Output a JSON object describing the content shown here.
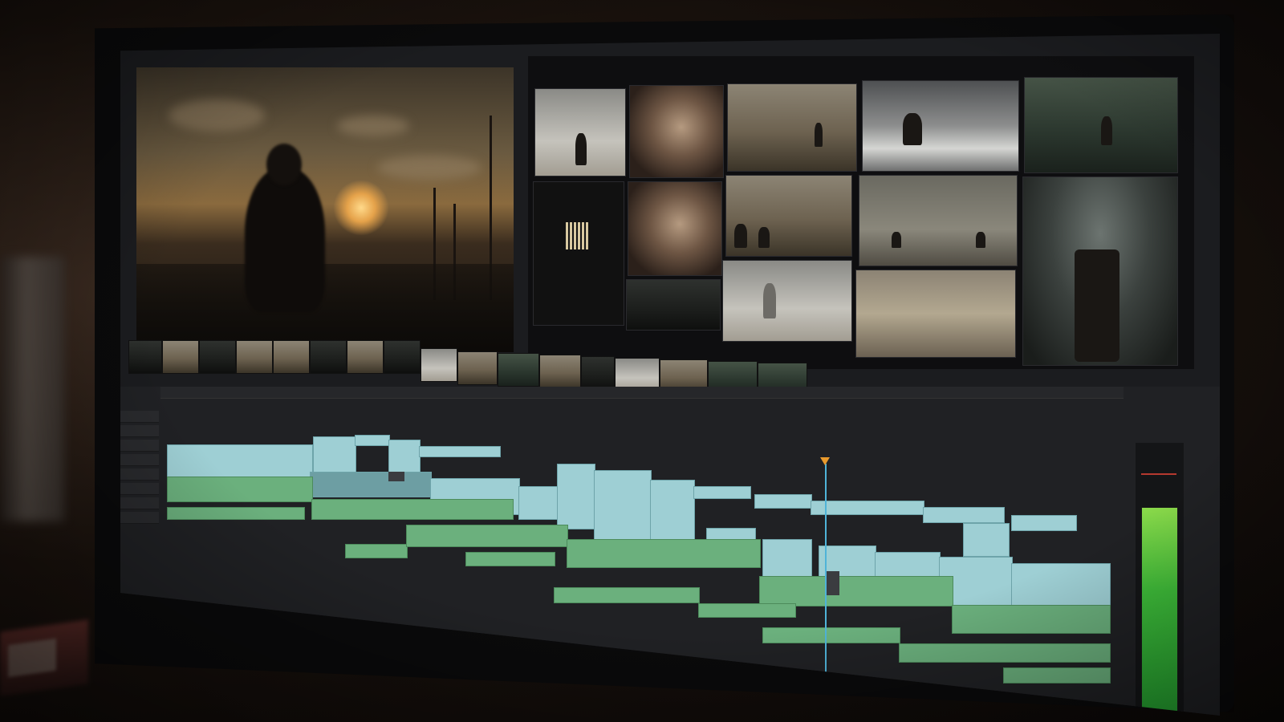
{
  "viewer": {
    "timecode": ""
  },
  "timeline": {
    "marker_labels": [
      "",
      "",
      "",
      "",
      ""
    ]
  },
  "colors": {
    "video_clip": "#9ecfd4",
    "audio_clip": "#6bb07d",
    "playhead": "#4fb3d8",
    "playhead_marker": "#e99a2c",
    "meter": "#3fbf3a"
  },
  "icons": [
    "playhead-marker-icon"
  ]
}
